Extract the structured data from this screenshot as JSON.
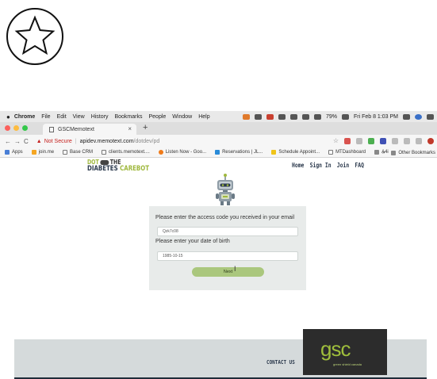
{
  "menubar": {
    "app": "Chrome",
    "items": [
      "File",
      "Edit",
      "View",
      "History",
      "Bookmarks",
      "People",
      "Window",
      "Help"
    ],
    "battery": "79%",
    "clock": "Fri Feb 8  1:03 PM"
  },
  "tabs": [
    {
      "title": "GSCMemotext"
    }
  ],
  "address": {
    "security": "Not Secure",
    "domain": "apidev.memotext.com",
    "path": "/dotdev/pd"
  },
  "bookmarks": {
    "items": [
      "Apps",
      "join.me",
      "Base CRM",
      "clients.memotext....",
      "Listen Now - Goo...",
      "Reservations | JL...",
      "Schedule Appoint...",
      "MTDashboard",
      "A4i"
    ],
    "more": "»",
    "other": "Other Bookmarks"
  },
  "site": {
    "logo_dot": "DOT",
    "logo_the": "THE",
    "logo_diabetes": "DIABETES",
    "logo_carebot": "CAREBOT",
    "nav": [
      "Home",
      "Sign In",
      "Join",
      "FAQ"
    ]
  },
  "form": {
    "access_label": "Please enter the access code you received in your email",
    "access_value": "Qzk7c08",
    "dob_label": "Please enter your date of birth",
    "dob_value": "1985-10-15",
    "next_label": "Next"
  },
  "footer": {
    "contact": "CONTACT US",
    "brand": "gsc",
    "brand_tagline": "green shield canada"
  },
  "colors": {
    "accent_green": "#9fb83d",
    "button_green": "#aac77d",
    "navy": "#2c3a4d",
    "not_secure_red": "#c5221f"
  },
  "icons": [
    "star-outline-icon",
    "apple-icon",
    "robot-icon"
  ]
}
